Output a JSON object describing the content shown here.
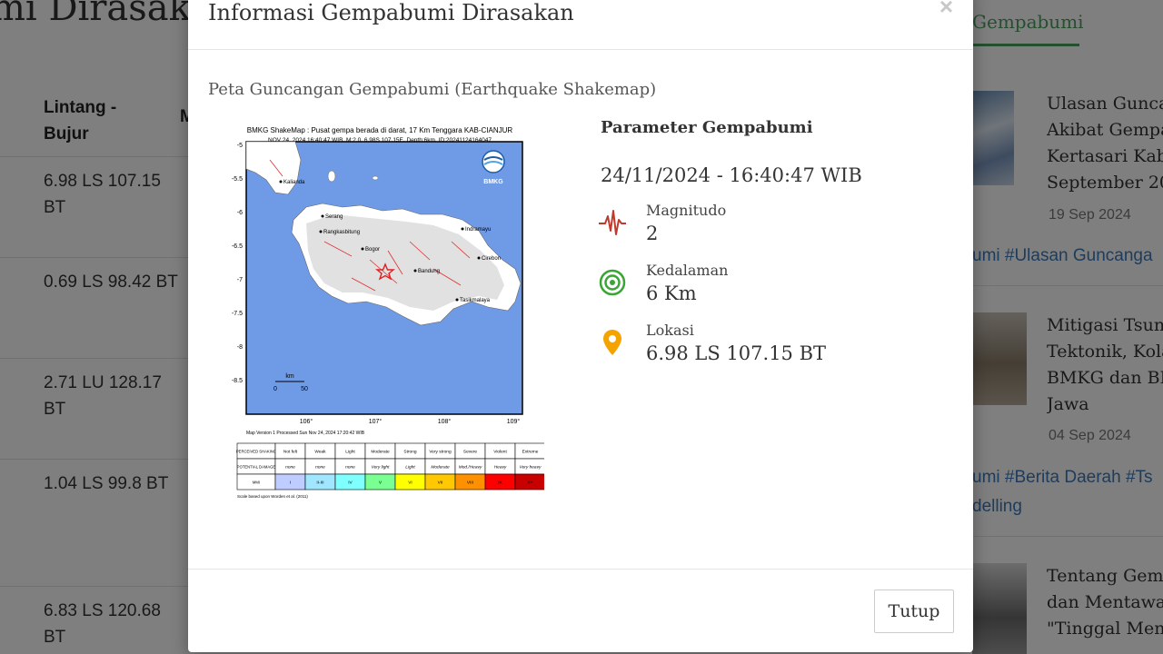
{
  "background": {
    "page_title": "mi Dirasakan",
    "tab_label": "Gempabumi",
    "table": {
      "header_lat_lon": "Lintang - Bujur",
      "header_next": "M",
      "rows": [
        {
          "lat_lon": "6.98 LS 107.15 BT"
        },
        {
          "lat_lon": "0.69 LS 98.42 BT"
        },
        {
          "lat_lon": "2.71 LU 128.17 BT"
        },
        {
          "lat_lon": "1.04 LS 99.8 BT"
        },
        {
          "lat_lon": "6.83 LS 120.68 BT"
        }
      ]
    },
    "news": [
      {
        "title_lines": [
          "Ulasan Guncan",
          "Akibat Gempa",
          "Kertasari Kab",
          "September 20"
        ],
        "date": "19 Sep 2024",
        "tags": [
          "umi #Ulasan Guncanga"
        ]
      },
      {
        "title_lines": [
          "Mitigasi Tsun",
          "Tektonik, Kola",
          "BMKG dan BR",
          "Jawa"
        ],
        "date": "04 Sep 2024",
        "tags": [
          "umi #Berita Daerah #Ts",
          "delling"
        ]
      },
      {
        "title_lines": [
          "Tentang Gem",
          "dan Mentawa",
          "\"Tinggal Men"
        ]
      }
    ]
  },
  "modal": {
    "title": "Informasi Gempabumi Dirasakan",
    "close_symbol": "×",
    "shakemap_heading": "Peta Guncangan Gempabumi (Earthquake Shakemap)",
    "shakemap": {
      "caption_line1": "BMKG ShakeMap : Pusat gempa berada di darat, 17 Km Tenggara KAB-CIANJUR",
      "caption_line2": "NOV 24, 2024 16:40:47 WIB, M:2.0, 6.98S 107.15E, Depth:6km, ID:20241124164047",
      "logo_text": "BMKG",
      "lat_ticks": [
        "-5",
        "-5.5",
        "-6",
        "-6.5",
        "-7",
        "-7.5",
        "-8",
        "-8.5"
      ],
      "lon_ticks": [
        "106°",
        "107°",
        "108°",
        "109°"
      ],
      "cities": [
        "Kalianda",
        "Serang",
        "Rangkasbitung",
        "Bogor",
        "Bandung",
        "Indramayu",
        "Cirebon",
        "Tasikmalaya"
      ],
      "scale_label": "km",
      "scale_ticks": [
        "0",
        "50"
      ],
      "version_note": "Map Version 1 Processed Sun Nov 24, 2024 17:20:42 WIB",
      "legend": {
        "row_labels": [
          "PERCEIVED SHAKING",
          "POTENTIAL DAMAGE",
          "MMI"
        ],
        "shaking": [
          "Not felt",
          "Weak",
          "Light",
          "Moderate",
          "Strong",
          "Very strong",
          "Severe",
          "Violent",
          "Extreme"
        ],
        "damage": [
          "none",
          "none",
          "none",
          "Very light",
          "Light",
          "Moderate",
          "Mod./Heavy",
          "Heavy",
          "Very heavy"
        ],
        "mmi": [
          "I",
          "II-III",
          "IV",
          "V",
          "VI",
          "VII",
          "VIII",
          "IX",
          "X+"
        ],
        "colors": [
          "#ffffff",
          "#bfccff",
          "#a0e6ff",
          "#80ffff",
          "#7aff93",
          "#ffff00",
          "#ffc800",
          "#ff9100",
          "#ff0000",
          "#c80000"
        ],
        "footnote": "Scale based upon Worden et al. (2011)"
      }
    },
    "parameters": {
      "heading": "Parameter Gempabumi",
      "datetime": "24/11/2024 - 16:40:47 WIB",
      "magnitude": {
        "label": "Magnitudo",
        "value": "2",
        "icon": "seismograph-icon"
      },
      "depth": {
        "label": "Kedalaman",
        "value": "6 Km",
        "icon": "depth-target-icon"
      },
      "location": {
        "label": "Lokasi",
        "value": "6.98 LS 107.15 BT",
        "icon": "location-pin-icon"
      }
    },
    "footer": {
      "close_button": "Tutup"
    },
    "colors": {
      "magnitude_icon": "#c0392b",
      "depth_icon": "#3aa535",
      "location_icon": "#f4a300",
      "map_sea": "#6f9be6"
    }
  }
}
